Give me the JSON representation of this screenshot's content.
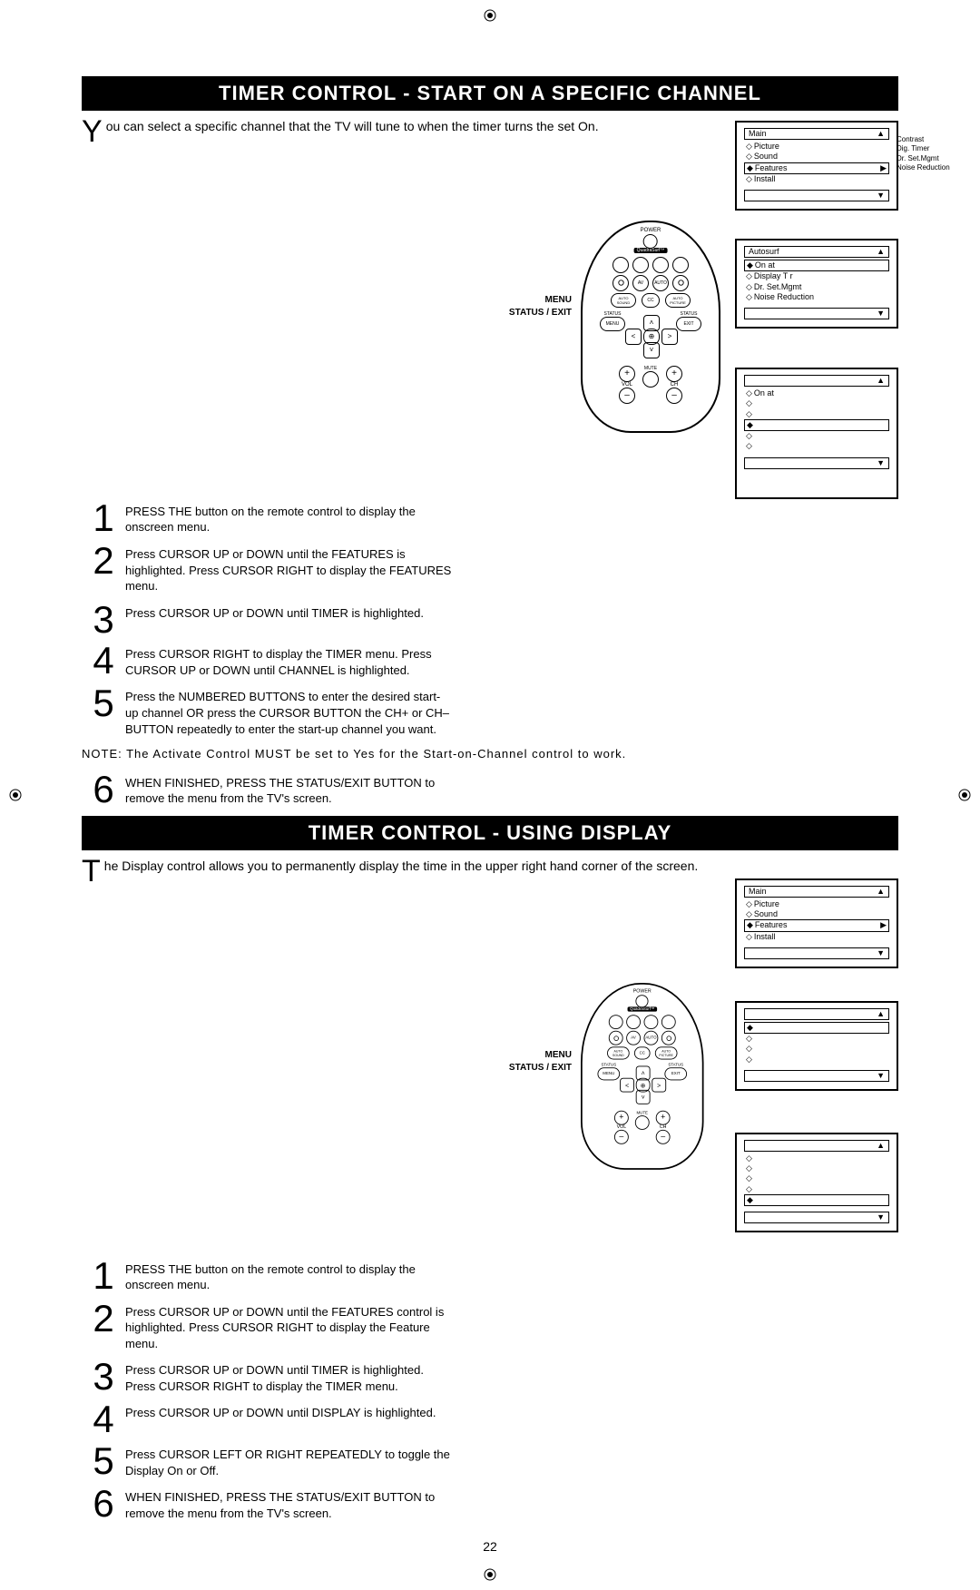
{
  "section1": {
    "title": "TIMER CONTROL -  START ON A SPECIFIC CHANNEL",
    "intro_cap": "Y",
    "intro": "ou can select a specific channel that the TV will tune to when the timer turns the set On.",
    "steps": {
      "1": "PRESS THE button on the remote control to display the onscreen menu.",
      "2": "Press CURSOR UP or DOWN until the FEATURES is highlighted. Press CURSOR RIGHT to display the FEATURES menu.",
      "3": "Press CURSOR UP or DOWN until TIMER is highlighted.",
      "4": "Press CURSOR RIGHT to display the TIMER menu. Press CURSOR UP or DOWN until CHANNEL is highlighted.",
      "5": "Press the NUMBERED BUTTONS to enter the desired start-up channel OR press the CURSOR BUTTON the CH+ or CH– BUTTON repeatedly to enter the start-up channel you want.",
      "6": "WHEN FINISHED, PRESS THE STATUS/EXIT BUTTON to remove the menu from the TV's screen."
    },
    "note": "NOTE: The Activate Control MUST be set to Yes for the Start-on-Channel control to work.",
    "labels": {
      "menu": "MENU",
      "exit": "STATUS / EXIT"
    },
    "remote": {
      "power": "POWER",
      "brand": "QuadraSurf™",
      "row2": [
        "",
        "AV",
        "AUTO",
        ""
      ],
      "row3": [
        "AUTO\nSOUND",
        "CC",
        "AUTO\nPICTURE"
      ],
      "status": "STATUS",
      "menu": "MENU",
      "exit": "EXIT",
      "mute": "MUTE",
      "vol": "VOL",
      "ch": "CH"
    },
    "osd_a": {
      "header_left": "Main",
      "header_right": "▲",
      "it1": "Picture",
      "it2": "Sound",
      "sel_l": "Features",
      "sel_r": "▶",
      "it3": "Install",
      "desc1": "Contrast",
      "desc2": "Dig. Timer",
      "desc3": "Dr. Set.Mgmt",
      "desc4": "Noise Reduction",
      "footer": "▼"
    },
    "osd_b": {
      "header_left": "Autosurf",
      "header_right": "▲",
      "sel_l": "On at",
      "sel_r": "",
      "it1": "Display   T  r",
      "it2": "Dr.     Set.Mgmt",
      "it3": "Noise Reduction",
      "footer": "▼"
    },
    "osd_c": {
      "header_right": "▲",
      "sel_l": "On at",
      "it1": "",
      "it2": "",
      "sel2": "",
      "it3": "",
      "it4": "",
      "footer": "▼"
    }
  },
  "section2": {
    "title": "TIMER CONTROL - USING  DISPLAY",
    "intro_cap": "T",
    "intro": "he Display control allows you to permanently display the time in the upper right hand corner of the screen.",
    "steps": {
      "1": "PRESS THE button on the remote control to display the onscreen menu.",
      "2": "Press CURSOR UP or DOWN until the FEATURES control is highlighted. Press CURSOR RIGHT to display the Feature menu.",
      "3": "Press CURSOR UP or DOWN until TIMER is highlighted. Press CURSOR RIGHT to display the TIMER menu.",
      "4": "Press CURSOR UP or DOWN until DISPLAY is highlighted.",
      "5": "Press CURSOR LEFT OR RIGHT REPEATEDLY to toggle the Display On or Off.",
      "6": "WHEN FINISHED, PRESS THE STATUS/EXIT BUTTON to remove the menu from the TV's screen."
    },
    "labels": {
      "menu": "MENU",
      "exit": "STATUS / EXIT"
    },
    "osd_a": {
      "header_left": "Main",
      "header_right": "▲",
      "it1": "Picture",
      "it2": "Sound",
      "sel_l": "Features",
      "sel_r": "▶",
      "it3": "Install",
      "footer": "▼"
    },
    "osd_b": {
      "header_right": "▲",
      "sel": "",
      "it1": "",
      "it2": "",
      "it3": "",
      "footer": "▼"
    },
    "osd_c": {
      "header_right": "▲",
      "it1": "",
      "it2": "",
      "it3": "",
      "it4": "",
      "sel": "",
      "footer": "▼"
    }
  },
  "page": "22"
}
